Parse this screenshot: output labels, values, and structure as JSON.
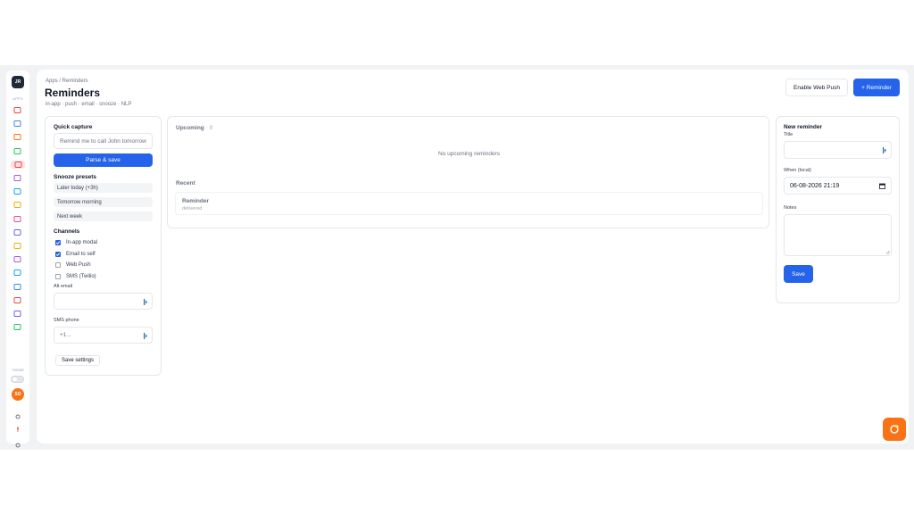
{
  "sidebar": {
    "workspace_initials": "JR",
    "apps_label": "APPS",
    "theme_label": "THEME",
    "user_initials": "SO",
    "nav_icons": [
      {
        "name": "mail-icon",
        "color": "#ef4444"
      },
      {
        "name": "user-plus-icon",
        "color": "#3b82f6"
      },
      {
        "name": "calendar-icon",
        "color": "#f97316"
      },
      {
        "name": "checkbox-icon",
        "color": "#22c55e"
      },
      {
        "name": "bell-icon",
        "color": "#ef4444"
      },
      {
        "name": "headphones-icon",
        "color": "#a855f7"
      },
      {
        "name": "cloud-icon",
        "color": "#0ea5e9"
      },
      {
        "name": "lock-icon",
        "color": "#eab308"
      },
      {
        "name": "users-icon",
        "color": "#ec4899"
      },
      {
        "name": "document-icon",
        "color": "#6366f1"
      },
      {
        "name": "note-icon",
        "color": "#eab308"
      },
      {
        "name": "image-icon",
        "color": "#a855f7"
      },
      {
        "name": "video-icon",
        "color": "#0ea5e9"
      },
      {
        "name": "bar-chart-icon",
        "color": "#3b82f6"
      },
      {
        "name": "help-icon",
        "color": "#ef4444"
      },
      {
        "name": "grid-icon",
        "color": "#6366f1"
      },
      {
        "name": "sheet-icon",
        "color": "#22c55e"
      }
    ]
  },
  "header": {
    "breadcrumb": "Apps / Reminders",
    "title": "Reminders",
    "subtitle": "in-app · push · email · snooze · NLP",
    "enable_push_label": "Enable Web Push",
    "add_reminder_label": "+ Reminder"
  },
  "quick_capture": {
    "title": "Quick capture",
    "input_placeholder": "Remind me to call John tomorrow",
    "parse_button": "Parse & save",
    "snooze_title": "Snooze presets",
    "presets": [
      "Later today (+3h)",
      "Tomorrow morning",
      "Next week"
    ],
    "channels_title": "Channels",
    "channels": [
      {
        "label": "In-app modal",
        "checked": true
      },
      {
        "label": "Email to self",
        "checked": true
      },
      {
        "label": "Web Push",
        "checked": false
      },
      {
        "label": "SMS (Twilio)",
        "checked": false
      }
    ],
    "alt_email_label": "Alt email",
    "alt_email_value": "",
    "sms_phone_label": "SMS phone",
    "sms_phone_placeholder": "+1...",
    "save_settings_label": "Save settings"
  },
  "upcoming": {
    "title": "Upcoming",
    "count": "· 0",
    "empty_message": "No upcoming reminders",
    "recent_title": "Recent",
    "recent_items": [
      {
        "title": "Reminder",
        "status": "delivered"
      }
    ]
  },
  "new_reminder": {
    "title": "New reminder",
    "title_field_label": "Title",
    "title_value": "",
    "when_label": "When (local)",
    "when_value": "06-08-2026 21:19",
    "notes_label": "Notes",
    "notes_value": "",
    "save_label": "Save"
  },
  "colors": {
    "primary": "#2563eb",
    "accent_orange": "#f97316"
  }
}
